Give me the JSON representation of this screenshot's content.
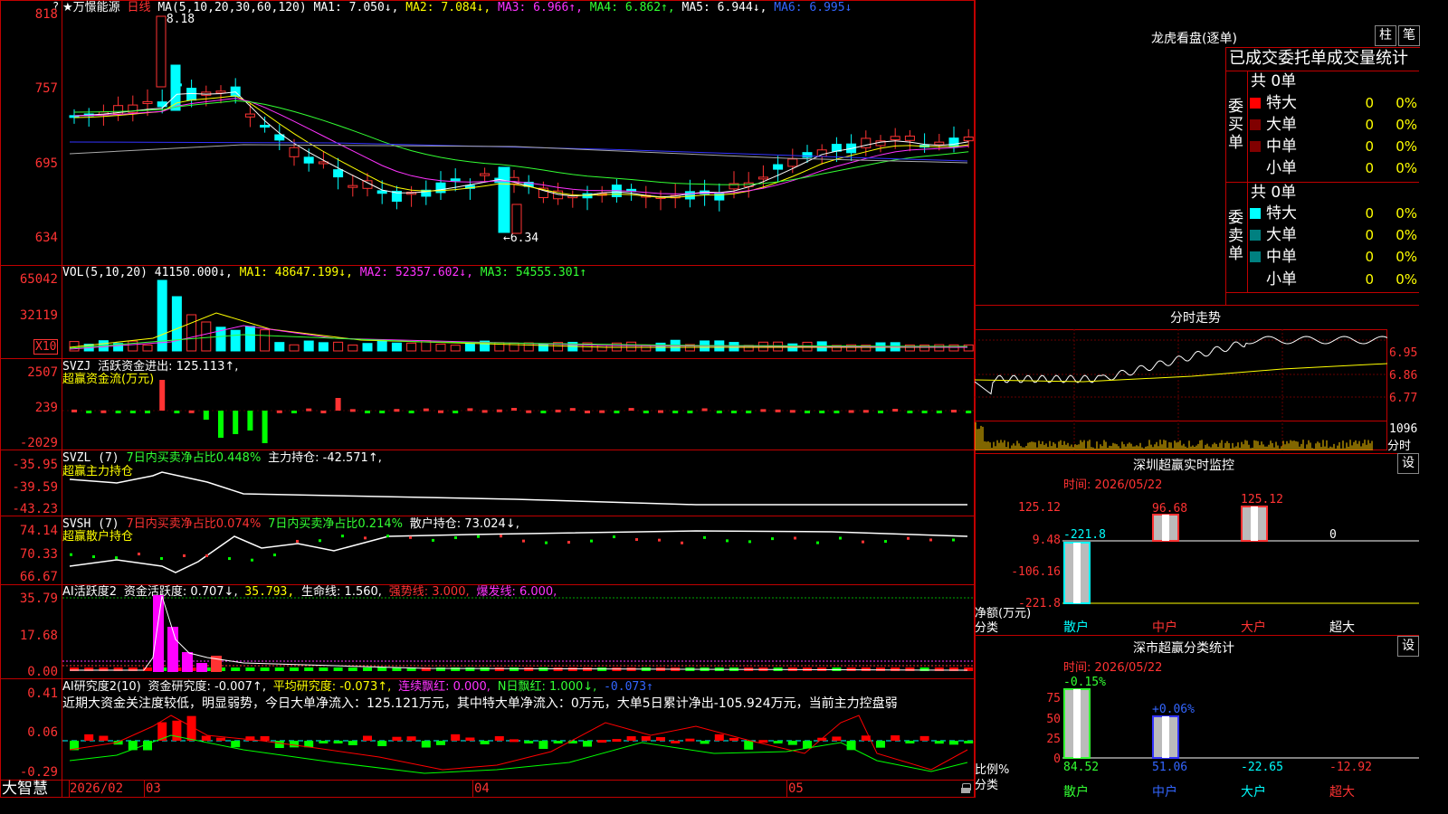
{
  "main": {
    "title": "★万憬能源",
    "period": "日线",
    "ma_label": "MA(5,10,20,30,60,120)",
    "ma1": "MA1: 7.050↓,",
    "ma2": "MA2: 7.084↓,",
    "ma3": "MA3: 6.966↑,",
    "ma4": "MA4: 6.862↑,",
    "ma5": "MA5: 6.944↓,",
    "ma6": "MA6: 6.995↓",
    "high_mark": "8.18",
    "low_mark": "6.34",
    "yticks": [
      "818",
      "757",
      "695",
      "634"
    ],
    "corner_mark": "?"
  },
  "vol": {
    "label": "VOL(5,10,20)",
    "value": "41150.000↓,",
    "ma1": "MA1: 48647.199↓,",
    "ma2": "MA2: 52357.602↓,",
    "ma3": "MA3: 54555.301↑",
    "yticks": [
      "65042",
      "32119"
    ],
    "unit": "X10"
  },
  "svzj": {
    "label": "SVZJ",
    "desc": "活跃资金进出: 125.113↑,",
    "name": "超赢资金流(万元)",
    "yticks": [
      "2507",
      "239",
      "-2029"
    ]
  },
  "svzl": {
    "label": "SVZL (7)",
    "desc1": "7日内买卖净占比0.448%",
    "desc2": "主力持仓: -42.571↑,",
    "name": "超赢主力持仓",
    "yticks": [
      "-35.95",
      "-39.59",
      "-43.23"
    ]
  },
  "svsh": {
    "label": "SVSH (7)",
    "desc1": "7日内买卖净占比0.074%",
    "desc2": "7日内买卖净占比0.214%",
    "desc3": "散户持仓: 73.024↓,",
    "name": "超赢散户持仓",
    "yticks": [
      "74.14",
      "70.33",
      "66.67"
    ]
  },
  "ai2": {
    "label": "AI活跃度2",
    "d1": "资金活跃度: 0.707↓,",
    "d2": "35.793,",
    "d3": "生命线: 1.560,",
    "d4": "强势线: 3.000,",
    "d5": "爆发线: 6.000,",
    "yticks": [
      "35.79",
      "17.68",
      "0.00"
    ]
  },
  "ai_research": {
    "label": "AI研究度2(10)",
    "d1": "资金研究度: -0.007↑,",
    "d2": "平均研究度: -0.073↑,",
    "d3": "连续飘红: 0.000,",
    "d4": "N日飘红: 1.000↓,",
    "d5": "-0.073↑",
    "note": "近期大资金关注度较低，明显弱势，今日大单净流入：125.121万元，其中特大单净流入：0万元，大单5日累计净出-105.924万元，当前主力控盘弱",
    "yticks": [
      "0.41",
      "0.06",
      "-0.29"
    ]
  },
  "axis": {
    "brand": "大智慧",
    "labels": [
      "2026/02",
      "03",
      "04",
      "05"
    ]
  },
  "right": {
    "title": "龙虎看盘(逐单)",
    "btn_zhu": "柱",
    "btn_bi": "笔",
    "stats_title": "已成交委托单成交量统计",
    "buy_label": "委买单",
    "sell_label": "委卖单",
    "buy_total": "共 0单",
    "sell_total": "共 0单",
    "buy_rows": [
      {
        "name": "特大",
        "v": "0",
        "p": "0%"
      },
      {
        "name": "大单",
        "v": "0",
        "p": "0%"
      },
      {
        "name": "中单",
        "v": "0",
        "p": "0%"
      },
      {
        "name": "小单",
        "v": "0",
        "p": "0%"
      }
    ],
    "sell_rows": [
      {
        "name": "特大",
        "v": "0",
        "p": "0%"
      },
      {
        "name": "大单",
        "v": "0",
        "p": "0%"
      },
      {
        "name": "中单",
        "v": "0",
        "p": "0%"
      },
      {
        "name": "小单",
        "v": "0",
        "p": "0%"
      }
    ],
    "colors": {
      "buy": [
        "#ff0000",
        "#800000",
        "#800000"
      ],
      "sell": [
        "#00ffff",
        "#008080",
        "#008080"
      ]
    },
    "fenshi": {
      "title": "分时走势",
      "yticks": [
        "6.95",
        "6.86",
        "6.77"
      ],
      "vol_tick": "1096",
      "unit": "分时"
    },
    "sz_monitor": {
      "title": "深圳超赢实时监控",
      "settings": "设",
      "time": "时间: 2026/05/22",
      "yticks": [
        "125.12",
        "9.48",
        "-106.16",
        "-221.8"
      ],
      "bar_labels": [
        "-221.8",
        "96.68",
        "125.12",
        "0"
      ],
      "y_title": "净额(万元)",
      "cat_title": "分类",
      "categories": [
        "散户",
        "中户",
        "大户",
        "超大"
      ]
    },
    "sz_class": {
      "title": "深市超赢分类统计",
      "settings": "设",
      "time": "时间: 2026/05/22",
      "yticks": [
        "75",
        "50",
        "25",
        "0"
      ],
      "top_labels": [
        "-0.15%",
        "+0.06%"
      ],
      "bottom_values": [
        "84.52",
        "51.06",
        "-22.65",
        "-12.92"
      ],
      "y_title": "比例%",
      "cat_title": "分类",
      "categories": [
        "散户",
        "中户",
        "大户",
        "超大"
      ]
    }
  }
}
